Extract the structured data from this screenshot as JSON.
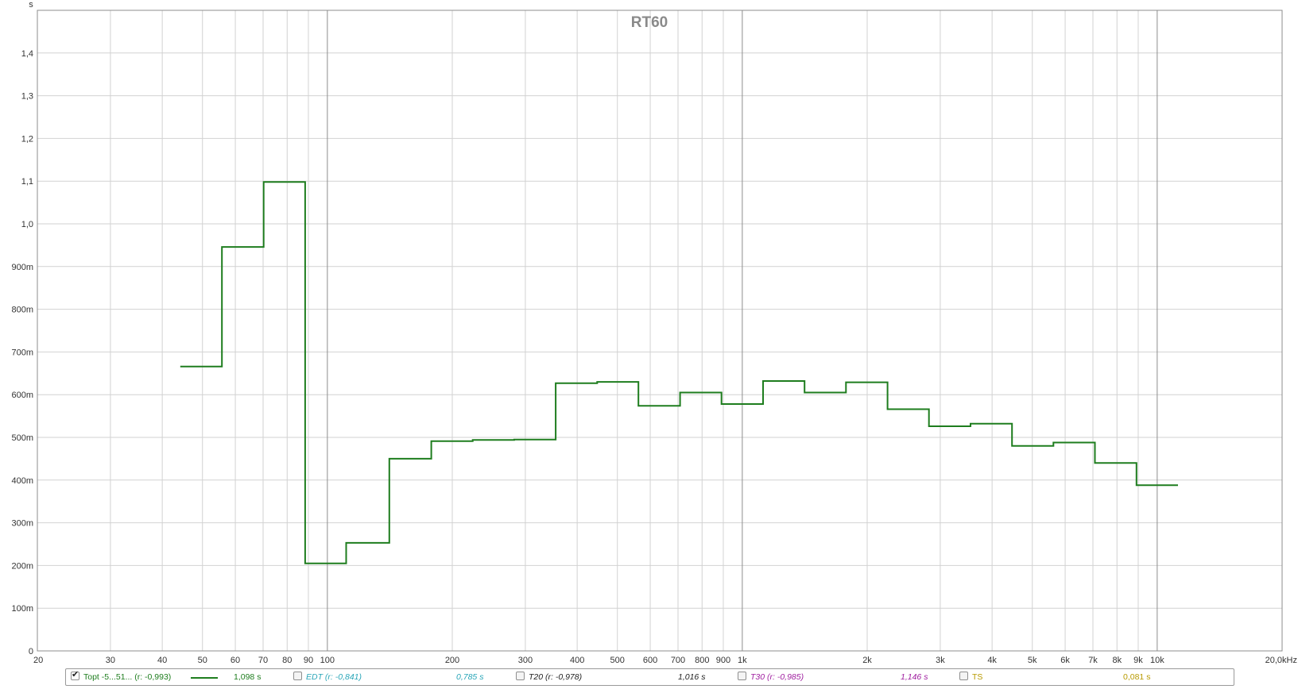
{
  "chart_data": {
    "type": "line",
    "title": "RT60",
    "ylabel": "s",
    "xlabel": "",
    "x_unit_label": "kHz",
    "x_scale": "log",
    "xlim": [
      20,
      20000
    ],
    "ylim": [
      0,
      1.5
    ],
    "grid": true,
    "x_ticks": [
      {
        "v": 20,
        "label": "20"
      },
      {
        "v": 30,
        "label": "30"
      },
      {
        "v": 40,
        "label": "40"
      },
      {
        "v": 50,
        "label": "50"
      },
      {
        "v": 60,
        "label": "60"
      },
      {
        "v": 70,
        "label": "70"
      },
      {
        "v": 80,
        "label": "80"
      },
      {
        "v": 90,
        "label": "90"
      },
      {
        "v": 100,
        "label": "100"
      },
      {
        "v": 200,
        "label": "200"
      },
      {
        "v": 300,
        "label": "300"
      },
      {
        "v": 400,
        "label": "400"
      },
      {
        "v": 500,
        "label": "500"
      },
      {
        "v": 600,
        "label": "600"
      },
      {
        "v": 700,
        "label": "700"
      },
      {
        "v": 800,
        "label": "800"
      },
      {
        "v": 900,
        "label": "900"
      },
      {
        "v": 1000,
        "label": "1k"
      },
      {
        "v": 2000,
        "label": "2k"
      },
      {
        "v": 3000,
        "label": "3k"
      },
      {
        "v": 4000,
        "label": "4k"
      },
      {
        "v": 5000,
        "label": "5k"
      },
      {
        "v": 6000,
        "label": "6k"
      },
      {
        "v": 7000,
        "label": "7k"
      },
      {
        "v": 8000,
        "label": "8k"
      },
      {
        "v": 9000,
        "label": "9k"
      },
      {
        "v": 10000,
        "label": "10k"
      },
      {
        "v": 20000,
        "label": "20,0kHz"
      }
    ],
    "major_x": [
      100,
      1000,
      10000
    ],
    "y_ticks": [
      {
        "v": 0,
        "label": "0"
      },
      {
        "v": 0.1,
        "label": "100m"
      },
      {
        "v": 0.2,
        "label": "200m"
      },
      {
        "v": 0.3,
        "label": "300m"
      },
      {
        "v": 0.4,
        "label": "400m"
      },
      {
        "v": 0.5,
        "label": "500m"
      },
      {
        "v": 0.6,
        "label": "600m"
      },
      {
        "v": 0.7,
        "label": "700m"
      },
      {
        "v": 0.8,
        "label": "800m"
      },
      {
        "v": 0.9,
        "label": "900m"
      },
      {
        "v": 1.0,
        "label": "1,0"
      },
      {
        "v": 1.1,
        "label": "1,1"
      },
      {
        "v": 1.2,
        "label": "1,2"
      },
      {
        "v": 1.3,
        "label": "1,3"
      },
      {
        "v": 1.4,
        "label": "1,4"
      }
    ],
    "series": [
      {
        "name": "Topt -5...51... (r: -0,993)",
        "color": "#1e7d1e",
        "style": "step",
        "edges": [
          44.2,
          55.7,
          70.2,
          88.4,
          111,
          141,
          178,
          224,
          282,
          355,
          447,
          562,
          708,
          891,
          1122,
          1413,
          1778,
          2239,
          2818,
          3548,
          4467,
          5623,
          7079,
          8913,
          11220
        ],
        "values": [
          0.666,
          0.946,
          1.098,
          0.205,
          0.253,
          0.45,
          0.491,
          0.494,
          0.495,
          0.627,
          0.63,
          0.574,
          0.605,
          0.578,
          0.632,
          0.605,
          0.629,
          0.566,
          0.526,
          0.532,
          0.48,
          0.488,
          0.44,
          0.388
        ]
      }
    ]
  },
  "legend": [
    {
      "label": "Topt -5...51... (r: -0,993)",
      "value": "1,098 s",
      "checked": true,
      "label_color": "#1e7d1e",
      "value_color": "#1e7d1e",
      "italic": false
    },
    {
      "label": "EDT (r: -0,841)",
      "value": "0,785 s",
      "checked": false,
      "label_color": "#2aa6b8",
      "value_color": "#2aa6b8",
      "italic": true
    },
    {
      "label": "T20 (r: -0,978)",
      "value": "1,016 s",
      "checked": false,
      "label_color": "#222222",
      "value_color": "#222222",
      "italic": true
    },
    {
      "label": "T30 (r: -0,985)",
      "value": "1,146 s",
      "checked": false,
      "label_color": "#a020a0",
      "value_color": "#a020a0",
      "italic": true
    },
    {
      "label": "TS",
      "value": "0,081 s",
      "checked": false,
      "label_color": "#b89a00",
      "value_color": "#b89a00",
      "italic": false
    }
  ]
}
